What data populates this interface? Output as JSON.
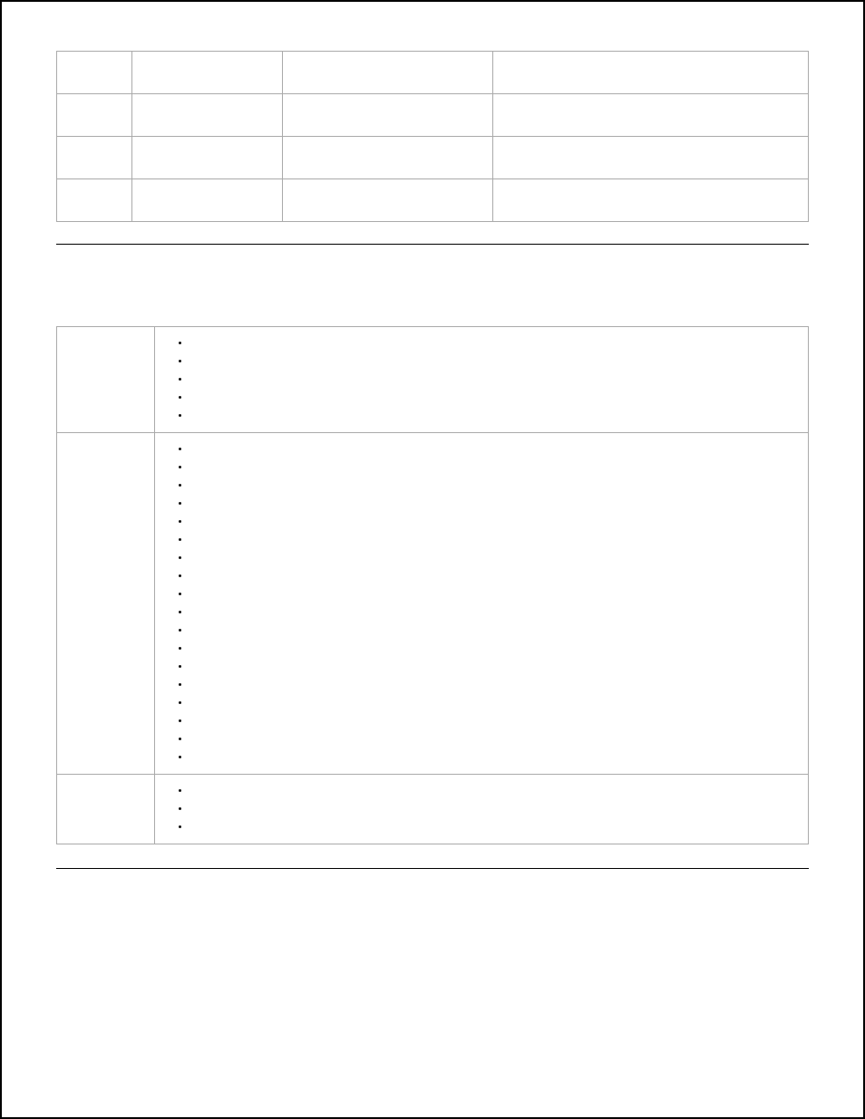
{
  "table1": {
    "rows": 4,
    "cols": 4
  },
  "table2": {
    "sections": [
      {
        "bullets": [
          "",
          "",
          "",
          "",
          ""
        ]
      },
      {
        "bullets": [
          "",
          "",
          "",
          "",
          "",
          "",
          "",
          "",
          "",
          "",
          "",
          "",
          "",
          "",
          "",
          "",
          "",
          ""
        ]
      },
      {
        "bullets": [
          "",
          "",
          ""
        ]
      }
    ]
  }
}
